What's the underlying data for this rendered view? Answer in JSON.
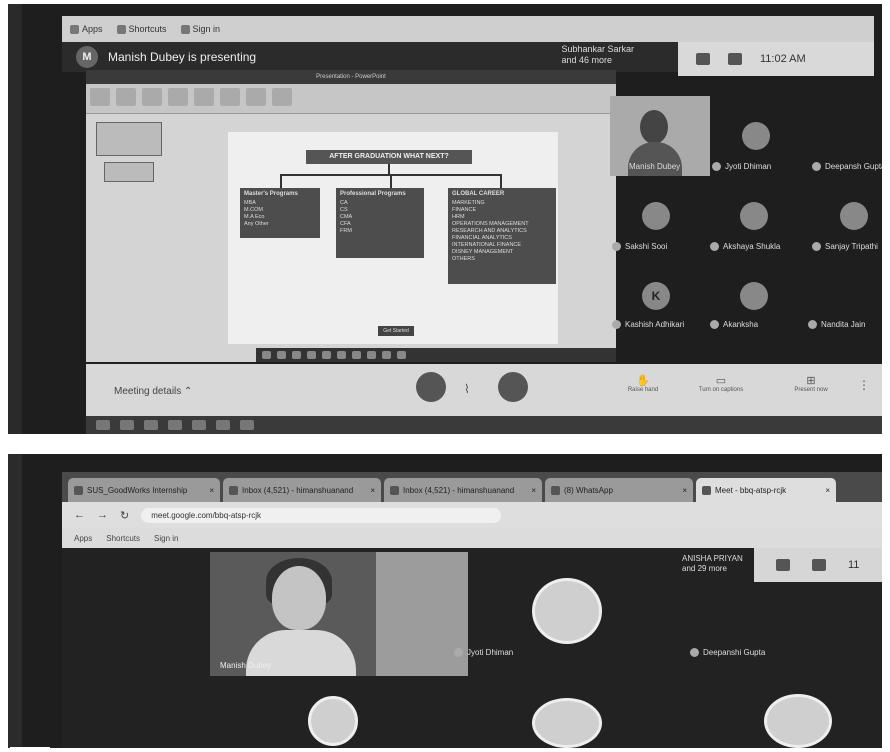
{
  "top_screen": {
    "bookmarks": [
      "Apps",
      "Shortcuts",
      "Sign in"
    ],
    "presenter_initial": "M",
    "presenting_text": "Manish Dubey is presenting",
    "participants_info": [
      "Subhankar Sarkar",
      "and 46 more"
    ],
    "time": "11:02 AM",
    "ppt_window_title": "Presentation - PowerPoint",
    "slide": {
      "title": "AFTER GRADUATION WHAT NEXT?",
      "boxes": [
        {
          "heading": "Master's Programs",
          "items": [
            "MBA",
            "M.COM",
            "M.A Eco",
            "Any Other"
          ]
        },
        {
          "heading": "Professional Programs",
          "items": [
            "CA",
            "CS",
            "CMA",
            "CFA",
            "FRM"
          ]
        },
        {
          "heading": "GLOBAL CAREER",
          "items": [
            "MARKETING",
            "FINANCE",
            "HRM",
            "OPERATIONS MANAGEMENT",
            "RESEARCH AND ANALYTICS",
            "FINANCIAL ANALYTICS",
            "INTERNATIONAL FINANCE",
            "DISNEY MANAGEMENT",
            "OTHERS"
          ]
        }
      ],
      "footer_label": "Get Started"
    },
    "participants": [
      {
        "name": "Manish Dubey",
        "initial": ""
      },
      {
        "name": "Jyoti Dhiman",
        "initial": ""
      },
      {
        "name": "Deepansh Gupta",
        "initial": ""
      },
      {
        "name": "Sakshi Sooi",
        "initial": ""
      },
      {
        "name": "Akshaya Shukla",
        "initial": ""
      },
      {
        "name": "Sanjay Tripathi",
        "initial": ""
      },
      {
        "name": "Kashish Adhikari",
        "initial": "K"
      },
      {
        "name": "Akanksha",
        "initial": ""
      },
      {
        "name": "Nandita Jain",
        "initial": ""
      }
    ],
    "meeting_details_label": "Meeting details",
    "control_labels": [
      "Raise hand",
      "Turn on captions",
      "Present now"
    ]
  },
  "bottom_screen": {
    "tabs": [
      {
        "label": "SUS_GoodWorks Internship",
        "active": false
      },
      {
        "label": "Inbox (4,521) - himanshuanand",
        "active": false
      },
      {
        "label": "Inbox (4,521) - himanshuanand",
        "active": false
      },
      {
        "label": "(8) WhatsApp",
        "active": false
      },
      {
        "label": "Meet - bbq-atsp-rcjk",
        "active": true
      }
    ],
    "url": "meet.google.com/bbq-atsp-rcjk",
    "bookmarks": [
      "Apps",
      "Shortcuts",
      "Sign in"
    ],
    "presenter_label": "Manish Dubey",
    "participants_info": [
      "ANISHA PRIYAN",
      "and 29 more"
    ],
    "time_partial": "11",
    "participants": [
      "Jyoti Dhiman",
      "Deepanshi Gupta"
    ]
  }
}
